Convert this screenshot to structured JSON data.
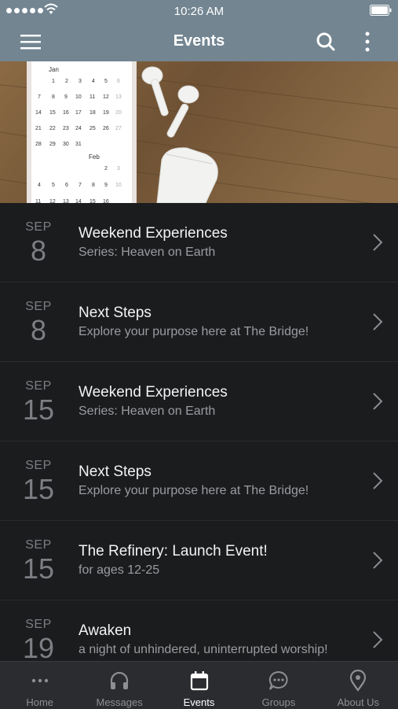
{
  "status_bar": {
    "time": "10:26 AM"
  },
  "header": {
    "title": "Events"
  },
  "hero": {
    "calendar_month_1": "Jan",
    "calendar_month_2": "Feb"
  },
  "events": [
    {
      "month": "SEP",
      "day": "8",
      "title": "Weekend Experiences",
      "subtitle": "Series: Heaven on Earth"
    },
    {
      "month": "SEP",
      "day": "8",
      "title": "Next Steps",
      "subtitle": "Explore your purpose here at The Bridge!"
    },
    {
      "month": "SEP",
      "day": "15",
      "title": "Weekend Experiences",
      "subtitle": "Series: Heaven on Earth"
    },
    {
      "month": "SEP",
      "day": "15",
      "title": "Next Steps",
      "subtitle": "Explore your purpose here at The Bridge!"
    },
    {
      "month": "SEP",
      "day": "15",
      "title": "The Refinery: Launch Event!",
      "subtitle": "for ages 12-25"
    },
    {
      "month": "SEP",
      "day": "19",
      "title": "Awaken",
      "subtitle": "a night of unhindered, uninterrupted worship!"
    }
  ],
  "tabs": [
    {
      "label": "Home",
      "icon": "dots-icon"
    },
    {
      "label": "Messages",
      "icon": "headphones-icon"
    },
    {
      "label": "Events",
      "icon": "calendar-icon",
      "active": true
    },
    {
      "label": "Groups",
      "icon": "chat-bubble-icon"
    },
    {
      "label": "About Us",
      "icon": "location-pin-icon"
    }
  ],
  "colors": {
    "header_bg": "#728591",
    "list_bg": "#1b1c1e",
    "tab_bar_bg": "#2b2c2f"
  }
}
